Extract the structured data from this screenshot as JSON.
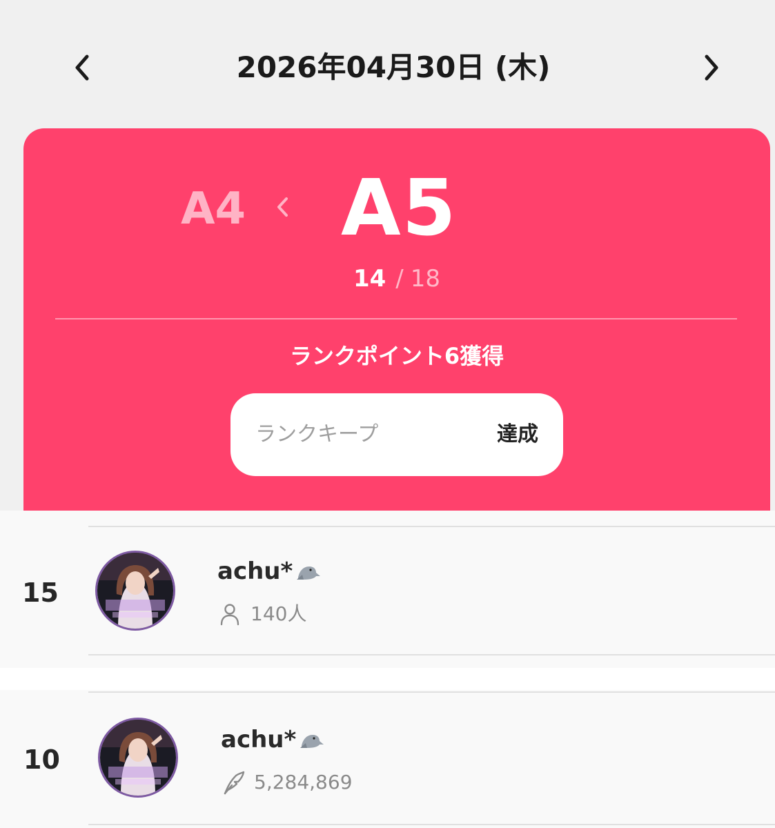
{
  "header": {
    "date": "2026年04月30日 (木)",
    "prev_icon": "chevron-left-icon",
    "next_icon": "chevron-right-icon"
  },
  "rank_card": {
    "previous_rank": "A4",
    "current_rank": "A5",
    "progress_current": "14",
    "progress_separator": "/",
    "progress_total": "18",
    "points_text": "ランクポイント6獲得",
    "keep_label": "ランクキープ",
    "keep_status": "達成",
    "background_color": "#ff416c"
  },
  "rankings": [
    {
      "rank": "15",
      "name": "achu*",
      "name_emoji": "seal-emoji",
      "stat_icon": "person-icon",
      "stat_value": "140人"
    },
    {
      "rank": "10",
      "name": "achu*",
      "name_emoji": "seal-emoji",
      "stat_icon": "feather-icon",
      "stat_value": "5,284,869"
    }
  ]
}
